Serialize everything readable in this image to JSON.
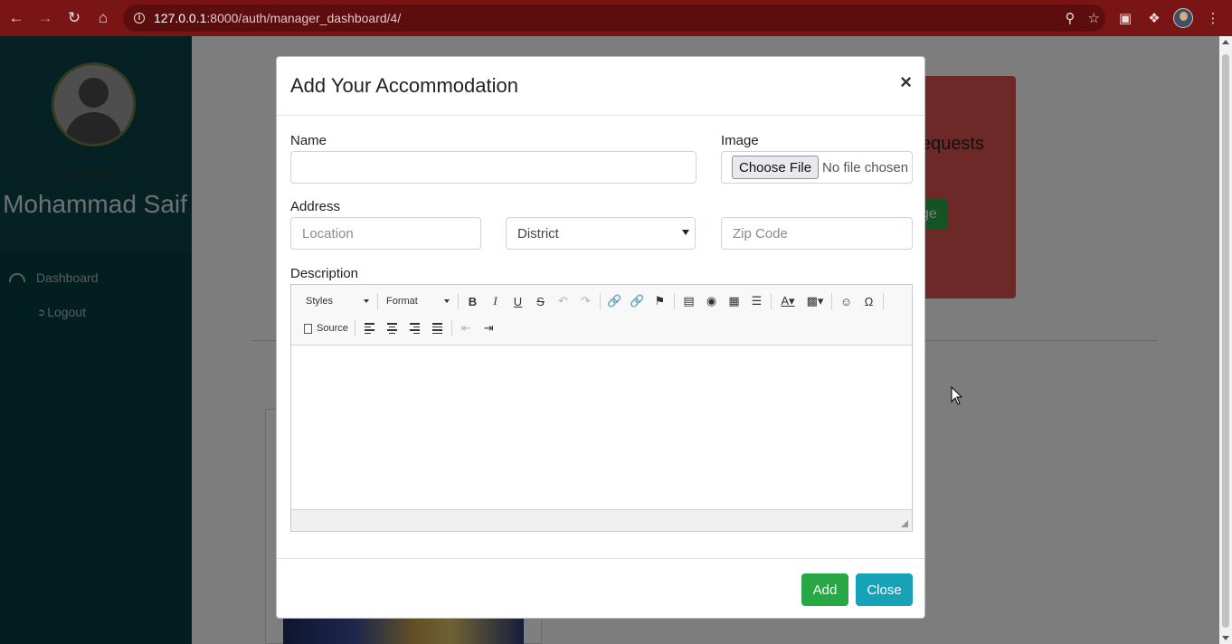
{
  "browser": {
    "url_host": "127.0.0.1",
    "url_path": ":8000/auth/manager_dashboard/4/"
  },
  "sidebar": {
    "role": "Manager",
    "user_name": "Mohammad Saif",
    "items": [
      {
        "label": "Dashboard",
        "icon": "gauge-icon"
      },
      {
        "label": "Logout",
        "icon": "logout-icon"
      }
    ]
  },
  "background": {
    "card_text": "equests",
    "card_button_text": "ge"
  },
  "modal": {
    "title": "Add Your Accommodation",
    "close_symbol": "×",
    "fields": {
      "name_label": "Name",
      "name_value": "",
      "image_label": "Image",
      "file_button": "Choose File",
      "file_status": "No file chosen",
      "address_label": "Address",
      "location_placeholder": "Location",
      "district_selected": "District",
      "zip_placeholder": "Zip Code",
      "description_label": "Description"
    },
    "editor": {
      "styles_label": "Styles",
      "format_label": "Format",
      "source_label": "Source"
    },
    "buttons": {
      "add": "Add",
      "close": "Close"
    }
  },
  "colors": {
    "chrome": "#7a1515",
    "sidebar": "#073c3e",
    "add_button": "#28a745",
    "close_button": "#17a2b8"
  }
}
